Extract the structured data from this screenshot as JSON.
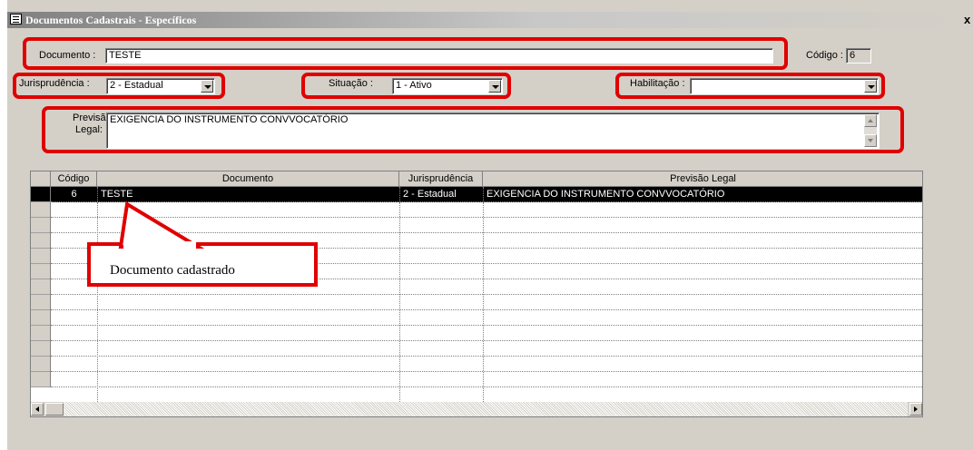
{
  "window": {
    "title": "Documentos Cadastrais  - Específicos",
    "close_glyph": "x"
  },
  "form": {
    "documento_label": "Documento :",
    "documento_value": "TESTE",
    "codigo_label": "Código :",
    "codigo_value": "6",
    "jurisprudencia_label": "Jurisprudência :",
    "jurisprudencia_value": "2 - Estadual",
    "situacao_label": "Situação :",
    "situacao_value": "1 - Ativo",
    "habilitacao_label": "Habilitação :",
    "habilitacao_value": "",
    "previsao_label_1": "Previsão",
    "previsao_label_2": "Legal:",
    "previsao_value": "EXIGENCIA DO INSTRUMENTO CONVVOCATÓRIO"
  },
  "grid": {
    "columns": [
      "Código",
      "Documento",
      "Jurisprudência",
      "Previsão Legal"
    ],
    "rows": [
      {
        "codigo": "6",
        "documento": "TESTE",
        "jurisprudencia": "2 - Estadual",
        "previsao": "EXIGENCIA DO INSTRUMENTO CONVVOCATÓRIO"
      }
    ]
  },
  "annotation": {
    "callout_text": "Documento cadastrado",
    "highlight_color": "#e00000"
  }
}
